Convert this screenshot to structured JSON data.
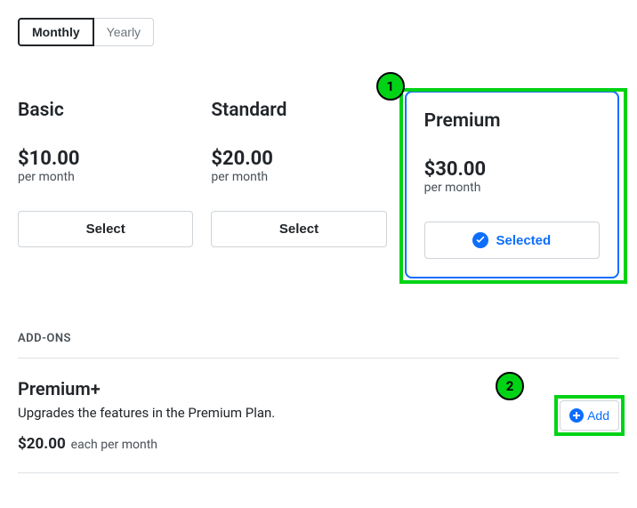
{
  "period": {
    "options": [
      "Monthly",
      "Yearly"
    ],
    "active": "Monthly"
  },
  "plans": [
    {
      "name": "Basic",
      "price": "$10.00",
      "period": "per month",
      "button": "Select",
      "selected": false
    },
    {
      "name": "Standard",
      "price": "$20.00",
      "period": "per month",
      "button": "Select",
      "selected": false
    },
    {
      "name": "Premium",
      "price": "$30.00",
      "period": "per month",
      "button": "Selected",
      "selected": true
    }
  ],
  "addons": {
    "title": "ADD-ONS",
    "items": [
      {
        "name": "Premium+",
        "desc": "Upgrades the features in the Premium Plan.",
        "price": "$20.00",
        "price_period": "each per month",
        "button": "Add"
      }
    ]
  },
  "annotations": {
    "a1": "1",
    "a2": "2"
  }
}
